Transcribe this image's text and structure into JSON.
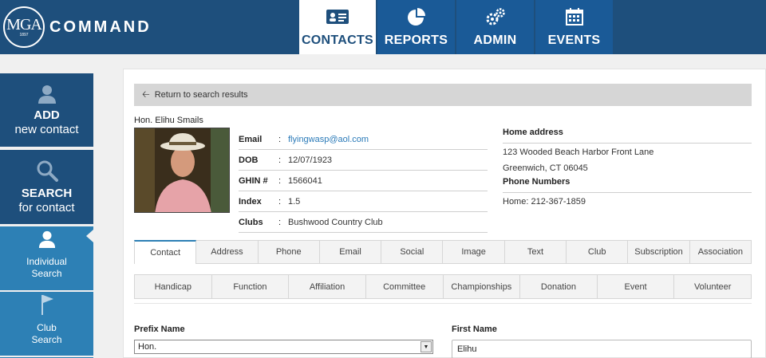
{
  "app": {
    "logo_text": "MGA",
    "logo_year": "1897",
    "title": "COMMAND"
  },
  "nav": {
    "tabs": [
      {
        "label": "CONTACTS",
        "icon": "contact-card-icon",
        "active": true
      },
      {
        "label": "REPORTS",
        "icon": "pie-chart-icon",
        "active": false
      },
      {
        "label": "ADMIN",
        "icon": "gears-icon",
        "active": false
      },
      {
        "label": "EVENTS",
        "icon": "calendar-icon",
        "active": false
      }
    ]
  },
  "sidebar": {
    "add": {
      "line1": "ADD",
      "line2": "new contact",
      "icon": "person-icon"
    },
    "search": {
      "line1": "SEARCH",
      "line2": "for contact",
      "icon": "magnifier-icon"
    },
    "individual": {
      "line1": "Individual",
      "line2": "Search",
      "icon": "person-icon"
    },
    "club": {
      "line1": "Club",
      "line2": "Search",
      "icon": "flag-icon"
    }
  },
  "back": {
    "label": "Return to search results"
  },
  "contact": {
    "name": "Hon. Elihu Smails",
    "fields": [
      {
        "label": "Email",
        "value": "flyingwasp@aol.com",
        "link": true
      },
      {
        "label": "DOB",
        "value": "12/07/1923"
      },
      {
        "label": "GHIN #",
        "value": "1566041"
      },
      {
        "label": "Index",
        "value": "1.5"
      },
      {
        "label": "Clubs",
        "value": "Bushwood Country Club"
      }
    ],
    "home_address_heading": "Home address",
    "address_line1": "123 Wooded Beach Harbor Front Lane",
    "address_line2": "Greenwich, CT 06045",
    "phone_heading": "Phone Numbers",
    "phone_home": "Home: 212-367-1859"
  },
  "tabs_row1": [
    "Contact",
    "Address",
    "Phone",
    "Email",
    "Social",
    "Image",
    "Text",
    "Club",
    "Subscription",
    "Association"
  ],
  "tabs_row2": [
    "Handicap",
    "Function",
    "Affiliation",
    "Committee",
    "Championships",
    "Donation",
    "Event",
    "Volunteer"
  ],
  "form": {
    "prefix_label": "Prefix Name",
    "prefix_value": "Hon.",
    "first_label": "First Name",
    "first_value": "Elihu"
  },
  "colors": {
    "header": "#1e4f7c",
    "nav_tab": "#1a5a97",
    "sidebar_light": "#2d80b5",
    "link": "#2a7ab8"
  }
}
